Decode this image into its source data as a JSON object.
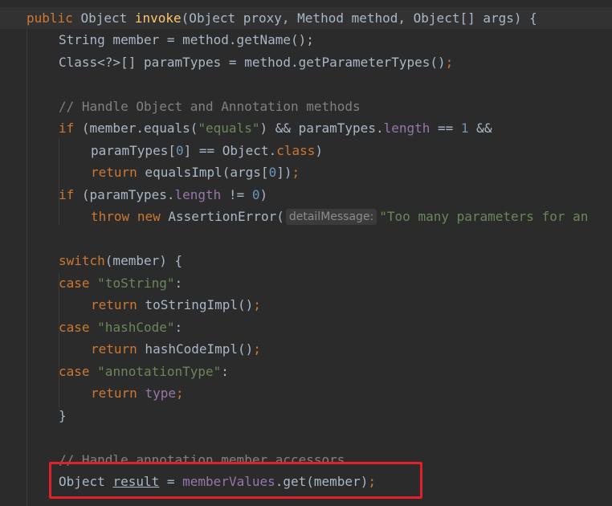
{
  "code": {
    "signature": {
      "public": "public",
      "type": "Object",
      "method": "invoke",
      "params": "(Object proxy, Method method, Object[] args) {"
    },
    "member_decl": "String member = method.getName();",
    "params_decl": {
      "left": "Class<?>[] paramTypes = method.getParameterTypes()",
      "semi": ";"
    },
    "comment1": "// Handle Object and Annotation methods",
    "if1": {
      "kw": "if",
      "a": " (member.equals(",
      "str": "\"equals\"",
      "b": ") && paramTypes.",
      "field": "length",
      "c": " == ",
      "num": "1",
      "d": " &&"
    },
    "if1_cont": {
      "a": "paramTypes[",
      "num": "0",
      "b": "] == Object.",
      "kw": "class",
      "c": ")"
    },
    "return_equals": {
      "kw": "return",
      "a": " equalsImpl(args[",
      "num": "0",
      "b": "])",
      "semi": ";"
    },
    "if2": {
      "kw": "if",
      "a": " (paramTypes.",
      "field": "length",
      "b": " != ",
      "num": "0",
      "c": ")"
    },
    "throw_line": {
      "kw1": "throw",
      "kw2": "new",
      "a": " AssertionError(",
      "hint": "detailMessage:",
      "str": "\"Too many parameters for an"
    },
    "switch_line": {
      "kw": "switch",
      "a": "(member) {"
    },
    "case1": {
      "kw": "case",
      "str": "\"toString\"",
      "colon": ":"
    },
    "ret1": {
      "kw": "return",
      "a": " toStringImpl()",
      "semi": ";"
    },
    "case2": {
      "kw": "case",
      "str": "\"hashCode\"",
      "colon": ":"
    },
    "ret2": {
      "kw": "return",
      "a": " hashCodeImpl()",
      "semi": ";"
    },
    "case3": {
      "kw": "case",
      "str": "\"annotationType\"",
      "colon": ":"
    },
    "ret3": {
      "kw": "return",
      "field": "type",
      "semi": ";"
    },
    "close_brace": "}",
    "comment2": "// Handle annotation member accessors",
    "result_line": {
      "a": "Object ",
      "local": "result",
      "b": " = ",
      "field": "memberValues",
      "c": ".get(member)",
      "semi": ";"
    }
  },
  "colors": {
    "background": "#2b2b2b",
    "keyword": "#cc7832",
    "method_name": "#ffc66d",
    "string": "#6a8759",
    "number": "#6897bb",
    "field": "#9876aa",
    "comment": "#808080",
    "highlight_box": "#e0202a"
  }
}
